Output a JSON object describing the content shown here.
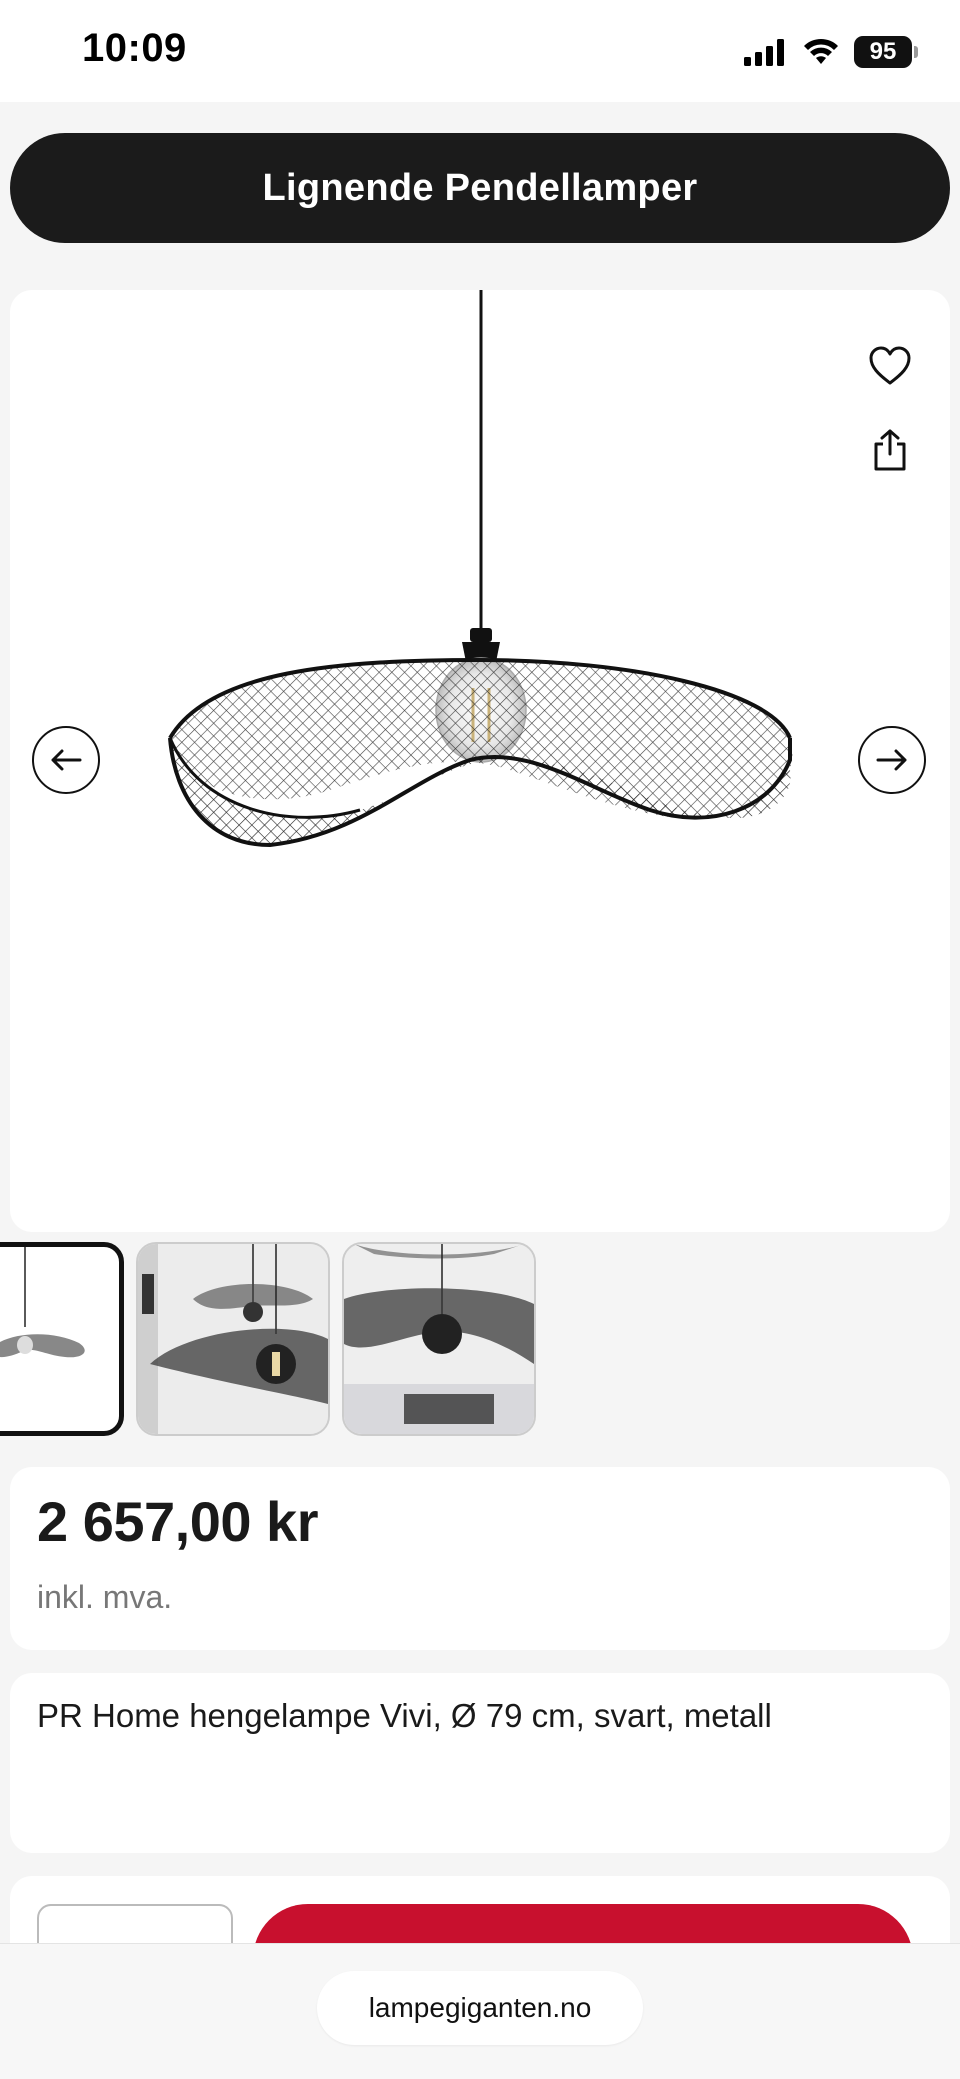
{
  "status_bar": {
    "time": "10:09",
    "battery": "95",
    "icons": [
      "signal-icon",
      "wifi-icon",
      "battery-icon"
    ]
  },
  "header": {
    "title": "Lignende Pendellamper"
  },
  "gallery": {
    "actions": [
      "heart-icon",
      "share-icon"
    ],
    "navigation": [
      "arrow-left-icon",
      "arrow-right-icon"
    ],
    "thumbnails": 3,
    "selected_thumbnail": 1
  },
  "product": {
    "price": "2 657,00 kr",
    "vat_note": "inkl. mva.",
    "title": "PR Home hengelampe Vivi, Ø 79 cm, svart, metall"
  },
  "colors": {
    "header_bg": "#1b1b1b",
    "buy_button": "#c8102e",
    "page_bg": "#f5f5f5"
  },
  "browser": {
    "url": "lampegiganten.no"
  }
}
